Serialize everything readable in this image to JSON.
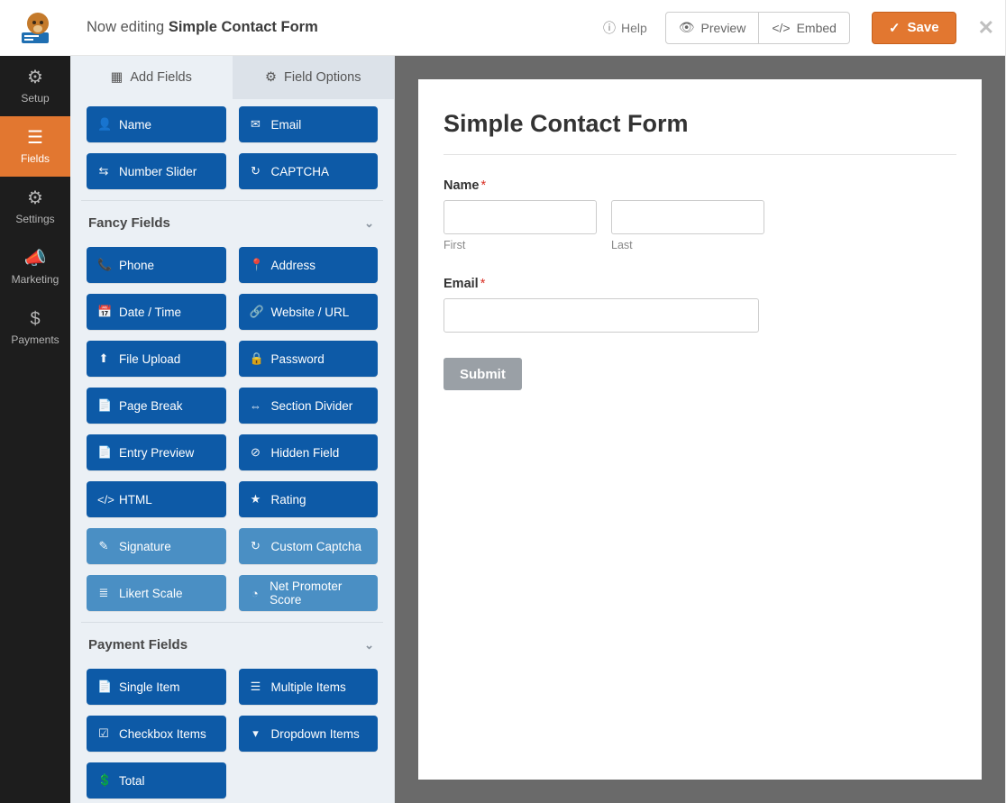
{
  "header": {
    "editing_prefix": "Now editing",
    "form_name": "Simple Contact Form",
    "help": "Help",
    "preview": "Preview",
    "embed": "Embed",
    "save": "Save"
  },
  "leftnav": {
    "setup": "Setup",
    "fields": "Fields",
    "settings": "Settings",
    "marketing": "Marketing",
    "payments": "Payments"
  },
  "tabs": {
    "add": "Add Fields",
    "options": "Field Options"
  },
  "top_fields": [
    {
      "label": "Name",
      "icon": "👤"
    },
    {
      "label": "Email",
      "icon": "✉"
    },
    {
      "label": "Number Slider",
      "icon": "⇆"
    },
    {
      "label": "CAPTCHA",
      "icon": "↻"
    }
  ],
  "sections": [
    {
      "title": "Fancy Fields",
      "items": [
        {
          "label": "Phone",
          "icon": "📞"
        },
        {
          "label": "Address",
          "icon": "📍"
        },
        {
          "label": "Date / Time",
          "icon": "📅"
        },
        {
          "label": "Website / URL",
          "icon": "🔗"
        },
        {
          "label": "File Upload",
          "icon": "⬆"
        },
        {
          "label": "Password",
          "icon": "🔒"
        },
        {
          "label": "Page Break",
          "icon": "📄"
        },
        {
          "label": "Section Divider",
          "icon": "⇔"
        },
        {
          "label": "Entry Preview",
          "icon": "📄"
        },
        {
          "label": "Hidden Field",
          "icon": "⊘"
        },
        {
          "label": "HTML",
          "icon": "</>"
        },
        {
          "label": "Rating",
          "icon": "★"
        },
        {
          "label": "Signature",
          "icon": "✎",
          "light": true
        },
        {
          "label": "Custom Captcha",
          "icon": "↻",
          "light": true
        },
        {
          "label": "Likert Scale",
          "icon": "≣",
          "light": true
        },
        {
          "label": "Net Promoter Score",
          "icon": "◔",
          "light": true
        }
      ]
    },
    {
      "title": "Payment Fields",
      "items": [
        {
          "label": "Single Item",
          "icon": "📄"
        },
        {
          "label": "Multiple Items",
          "icon": "☰"
        },
        {
          "label": "Checkbox Items",
          "icon": "☑"
        },
        {
          "label": "Dropdown Items",
          "icon": "▾"
        },
        {
          "label": "Total",
          "icon": "💲"
        }
      ]
    }
  ],
  "preview": {
    "title": "Simple Contact Form",
    "name_label": "Name",
    "first": "First",
    "last": "Last",
    "email_label": "Email",
    "submit": "Submit"
  }
}
